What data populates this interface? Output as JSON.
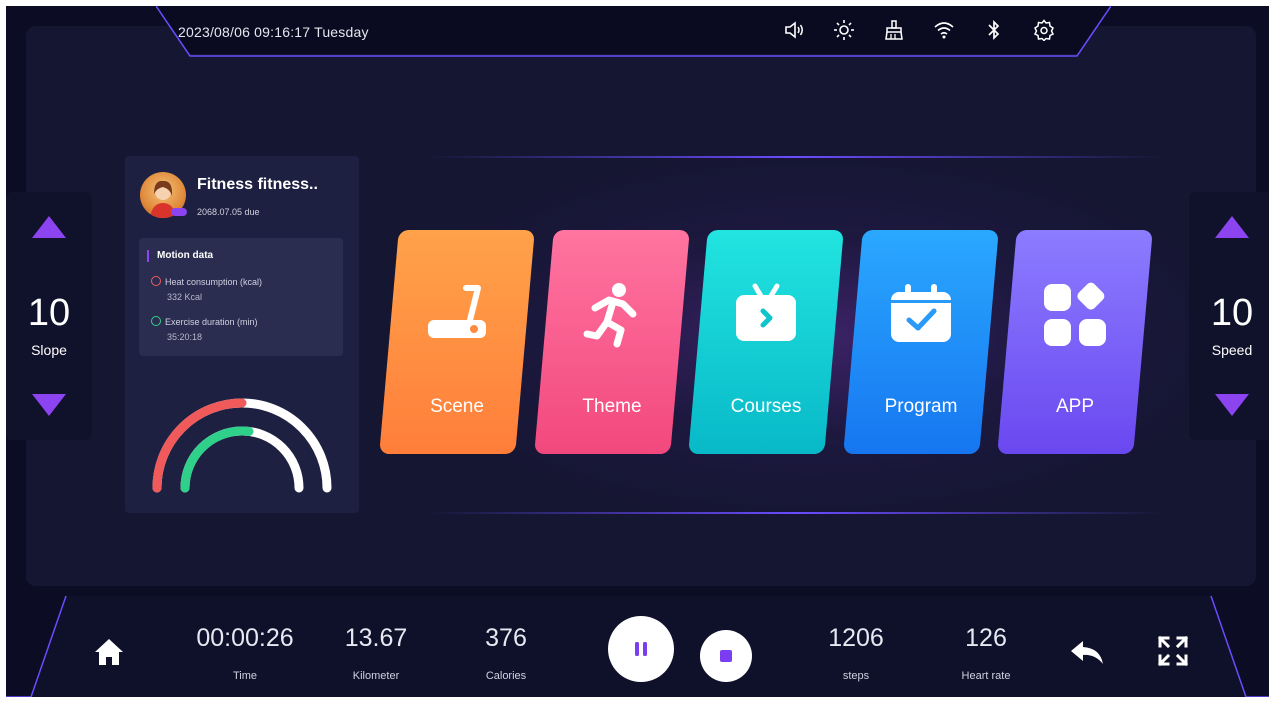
{
  "status": {
    "datetime": "2023/08/06 09:16:17  Tuesday",
    "icons": [
      "volume-icon",
      "brightness-icon",
      "broom-icon",
      "wifi-icon",
      "bluetooth-icon",
      "settings-icon"
    ]
  },
  "slope": {
    "value": "10",
    "label": "Slope"
  },
  "speed": {
    "value": "10",
    "label": "Speed"
  },
  "profile": {
    "name": "Fitness fitness..",
    "due": "2068.07.05 due",
    "motion_title": "Motion data",
    "heat_label": "Heat consumption (kcal)",
    "heat_value": "332 Kcal",
    "duration_label": "Exercise duration (min)",
    "duration_value": "35:20:18"
  },
  "tiles": [
    {
      "label": "Scene",
      "icon": "treadmill-icon",
      "color_top": "#ffa24a",
      "color_bottom": "#ff7e3a"
    },
    {
      "label": "Theme",
      "icon": "runner-icon",
      "color_top": "#ff74a0",
      "color_bottom": "#f2487e"
    },
    {
      "label": "Courses",
      "icon": "video-icon",
      "color_top": "#22e4e0",
      "color_bottom": "#08b9c8"
    },
    {
      "label": "Program",
      "icon": "calendar-check-icon",
      "color_top": "#2aa8ff",
      "color_bottom": "#1676f0"
    },
    {
      "label": "APP",
      "icon": "apps-icon",
      "color_top": "#8c7cff",
      "color_bottom": "#6a48f0"
    }
  ],
  "bottom": {
    "time": {
      "value": "00:00:26",
      "label": "Time"
    },
    "kilometer": {
      "value": "13.67",
      "label": "Kilometer"
    },
    "calories": {
      "value": "376",
      "label": "Calories"
    },
    "steps": {
      "value": "1206",
      "label": "steps"
    },
    "heart_rate": {
      "value": "126",
      "label": "Heart rate"
    }
  },
  "colors": {
    "accent": "#8b44f0",
    "background": "#0c0d25",
    "gauge_red": "#f05a5a",
    "gauge_green": "#2fd08a"
  }
}
